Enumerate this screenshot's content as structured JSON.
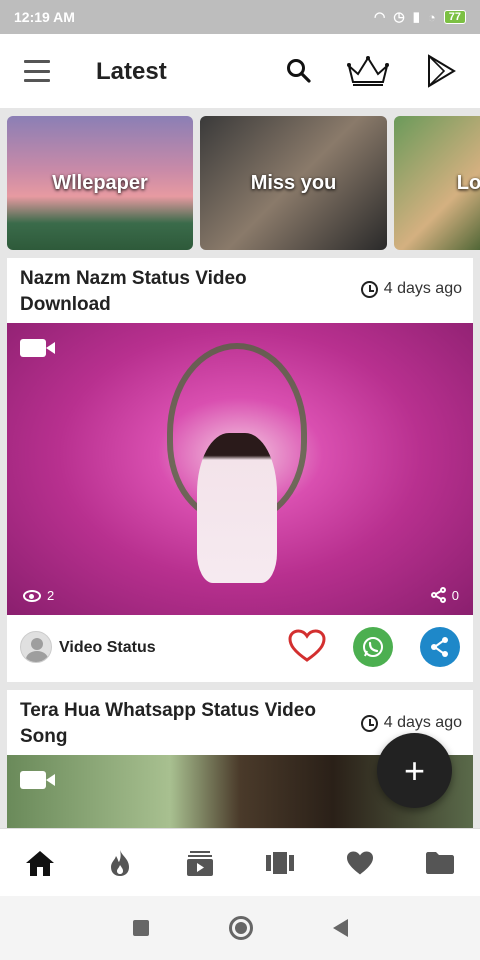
{
  "status_bar": {
    "time": "12:19 AM",
    "battery": "77"
  },
  "app_bar": {
    "title": "Latest"
  },
  "banners": [
    {
      "label": "Wllepaper"
    },
    {
      "label": "Miss you"
    },
    {
      "label": "Lo"
    }
  ],
  "posts": [
    {
      "title": "Nazm Nazm Status Video Download",
      "time_ago": "4 days ago",
      "views": "2",
      "shares": "0",
      "user": "Video Status"
    },
    {
      "title": "Tera Hua Whatsapp Status Video Song",
      "time_ago": "4 days ago"
    }
  ],
  "fab": {
    "label": "+"
  },
  "bottom_nav": [
    {
      "icon": "home-icon"
    },
    {
      "icon": "fire-icon"
    },
    {
      "icon": "subscriptions-icon"
    },
    {
      "icon": "carousel-icon"
    },
    {
      "icon": "heart-icon"
    },
    {
      "icon": "folder-icon"
    }
  ],
  "colors": {
    "accent": "#222222",
    "heart": "#d32f2f",
    "whatsapp": "#4caf50",
    "share": "#1e88c9"
  }
}
